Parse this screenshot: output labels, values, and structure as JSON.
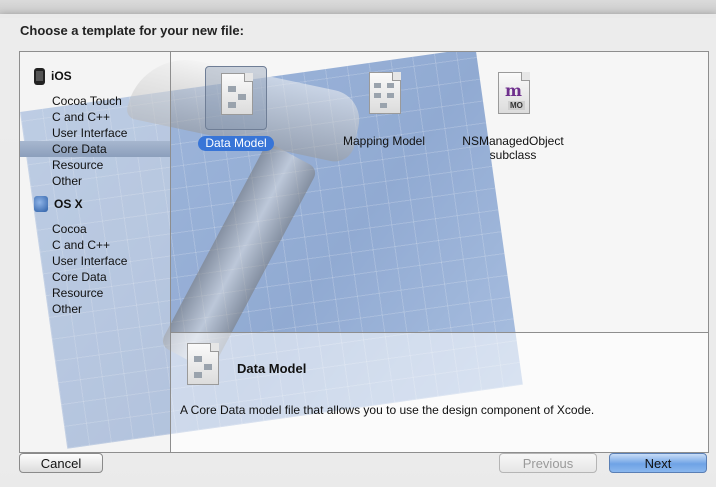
{
  "dialog": {
    "title": "Choose a template for your new file:"
  },
  "sidebar": {
    "groups": [
      {
        "label": "iOS",
        "icon": "iphone-icon",
        "items": [
          "Cocoa Touch",
          "C and C++",
          "User Interface",
          "Core Data",
          "Resource",
          "Other"
        ]
      },
      {
        "label": "OS X",
        "icon": "osx-icon",
        "items": [
          "Cocoa",
          "C and C++",
          "User Interface",
          "Core Data",
          "Resource",
          "Other"
        ]
      }
    ],
    "selected": "iOS / Core Data"
  },
  "templates": [
    {
      "label": "Data Model",
      "icon": "data-model-icon",
      "selected": true
    },
    {
      "label": "Mapping Model",
      "icon": "mapping-model-icon",
      "selected": false
    },
    {
      "label": "NSManagedObject subclass",
      "label_line1": "NSManagedObject",
      "label_line2": "subclass",
      "icon": "managed-object-icon",
      "selected": false
    }
  ],
  "detail": {
    "name": "Data Model",
    "description": "A Core Data model file that allows you to use the design component of Xcode."
  },
  "buttons": {
    "cancel": "Cancel",
    "previous": "Previous",
    "next": "Next"
  },
  "colors": {
    "selection": "#3875d7",
    "sidebar_selection": "#9aacc6"
  }
}
